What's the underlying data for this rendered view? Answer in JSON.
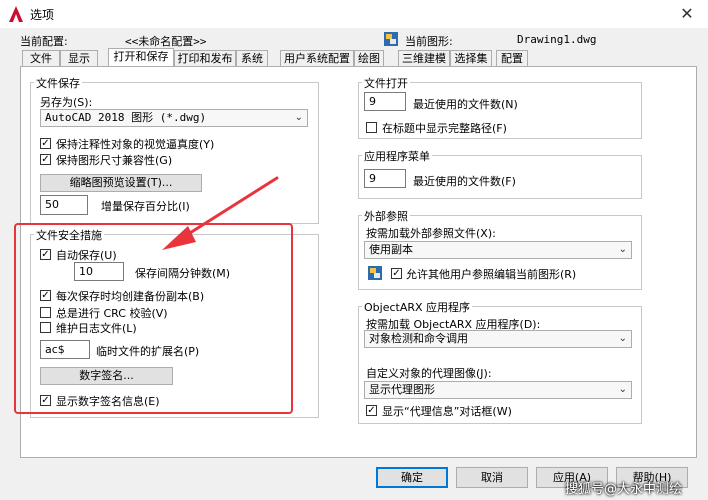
{
  "window": {
    "title": "选项"
  },
  "header": {
    "current_profile_label": "当前配置:",
    "current_profile_value": "<<未命名配置>>",
    "current_drawing_label": "当前图形:",
    "current_drawing_value": "Drawing1.dwg"
  },
  "tabs": [
    {
      "label": "文件"
    },
    {
      "label": "显示"
    },
    {
      "label": "打开和保存"
    },
    {
      "label": "打印和发布"
    },
    {
      "label": "系统"
    },
    {
      "label": "用户系统配置"
    },
    {
      "label": "绘图"
    },
    {
      "label": "三维建模"
    },
    {
      "label": "选择集"
    },
    {
      "label": "配置"
    }
  ],
  "file_save": {
    "title": "文件保存",
    "save_as_label": "另存为(S):",
    "save_as_value": "AutoCAD 2018 图形 (*.dwg)",
    "keep_annotative_label": "保持注释性对象的视觉逼真度(Y)",
    "keep_annotative_checked": true,
    "keep_drawing_size_label": "保持图形尺寸兼容性(G)",
    "keep_drawing_size_checked": true,
    "thumbnail_button": "缩略图预览设置(T)...",
    "incremental_value": "50",
    "incremental_label": "增量保存百分比(I)"
  },
  "file_safety": {
    "title": "文件安全措施",
    "autosave_label": "自动保存(U)",
    "autosave_checked": true,
    "interval_value": "10",
    "interval_label": "保存间隔分钟数(M)",
    "backup_label": "每次保存时均创建备份副本(B)",
    "backup_checked": true,
    "crc_label": "总是进行 CRC 校验(V)",
    "crc_checked": false,
    "log_label": "维护日志文件(L)",
    "log_checked": false,
    "temp_ext_value": "ac$",
    "temp_ext_label": "临时文件的扩展名(P)",
    "digital_sign_button": "数字签名...",
    "show_sign_label": "显示数字签名信息(E)",
    "show_sign_checked": true
  },
  "file_open": {
    "title": "文件打开",
    "recent_value": "9",
    "recent_label": "最近使用的文件数(N)",
    "fullpath_label": "在标题中显示完整路径(F)",
    "fullpath_checked": false
  },
  "app_menu": {
    "title": "应用程序菜单",
    "recent_value": "9",
    "recent_label": "最近使用的文件数(F)"
  },
  "xref": {
    "title": "外部参照",
    "demand_label": "按需加载外部参照文件(X):",
    "demand_value": "使用副本",
    "allow_edit_label": "允许其他用户参照编辑当前图形(R)",
    "allow_edit_checked": true
  },
  "objectarx": {
    "title": "ObjectARX 应用程序",
    "demand_label": "按需加载 ObjectARX 应用程序(D):",
    "demand_value": "对象检测和命令调用",
    "proxy_label": "自定义对象的代理图像(J):",
    "proxy_value": "显示代理图形",
    "show_proxy_label": "显示“代理信息”对话框(W)",
    "show_proxy_checked": true
  },
  "footer": {
    "ok": "确定",
    "cancel": "取消",
    "apply": "应用(A)",
    "help": "帮助(H)"
  },
  "watermark": "搜狐号@大永中测绘",
  "colors": {
    "highlight_box": "#e8343a",
    "primary_button_border": "#0078d7"
  }
}
